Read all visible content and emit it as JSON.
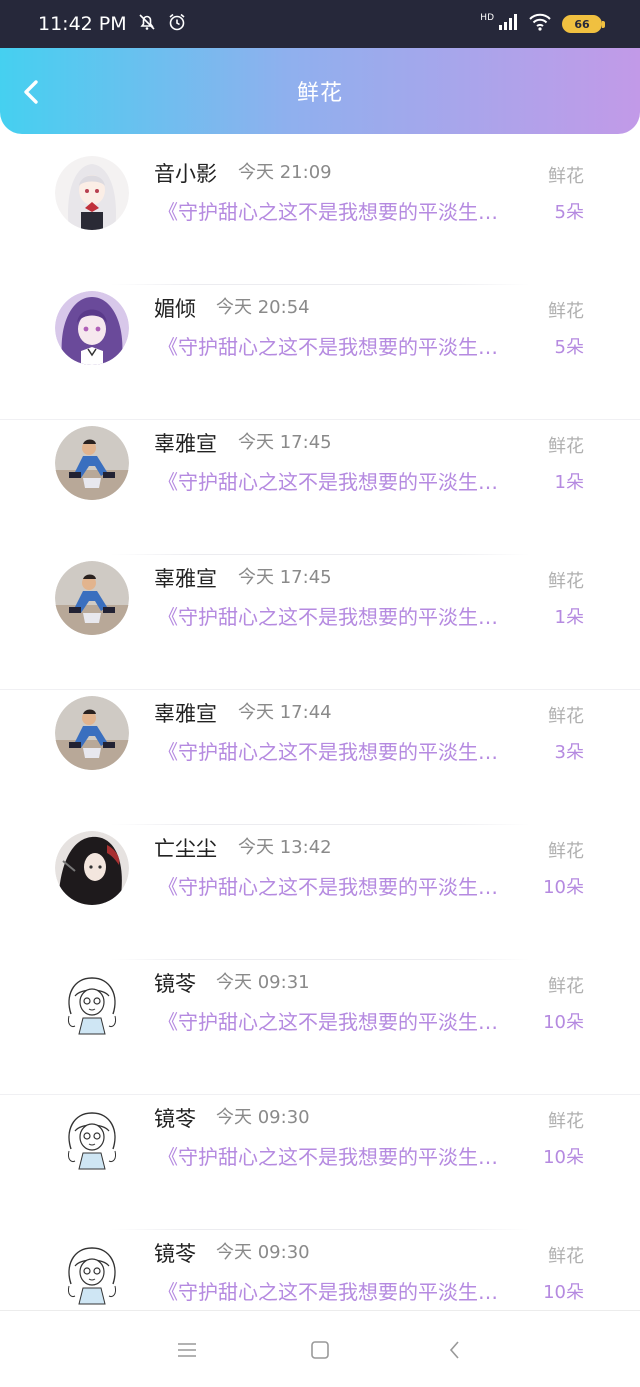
{
  "status": {
    "time": "11:42 PM",
    "network": "HD",
    "battery": "66"
  },
  "header": {
    "title": "鲜花"
  },
  "items": [
    {
      "name": "音小影",
      "time": "今天 21:09",
      "desc": "《守护甜心之这不是我想要的平淡生…",
      "label": "鲜花",
      "count": "5朵",
      "avatar": "anime-girl-white-hair"
    },
    {
      "name": "媚倾",
      "time": "今天 20:54",
      "desc": "《守护甜心之这不是我想要的平淡生…",
      "label": "鲜花",
      "count": "5朵",
      "avatar": "anime-girl-purple-hair"
    },
    {
      "name": "辜雅宣",
      "time": "今天 17:45",
      "desc": "《守护甜心之这不是我想要的平淡生…",
      "label": "鲜花",
      "count": "1朵",
      "avatar": "photo-person"
    },
    {
      "name": "辜雅宣",
      "time": "今天 17:45",
      "desc": "《守护甜心之这不是我想要的平淡生…",
      "label": "鲜花",
      "count": "1朵",
      "avatar": "photo-person"
    },
    {
      "name": "辜雅宣",
      "time": "今天 17:44",
      "desc": "《守护甜心之这不是我想要的平淡生…",
      "label": "鲜花",
      "count": "3朵",
      "avatar": "photo-person"
    },
    {
      "name": "亡尘尘",
      "time": "今天 13:42",
      "desc": "《守护甜心之这不是我想要的平淡生…",
      "label": "鲜花",
      "count": "10朵",
      "avatar": "anime-dark-hair"
    },
    {
      "name": "镜苓",
      "time": "今天 09:31",
      "desc": "《守护甜心之这不是我想要的平淡生…",
      "label": "鲜花",
      "count": "10朵",
      "avatar": "sketch-girl"
    },
    {
      "name": "镜苓",
      "time": "今天 09:30",
      "desc": "《守护甜心之这不是我想要的平淡生…",
      "label": "鲜花",
      "count": "10朵",
      "avatar": "sketch-girl"
    },
    {
      "name": "镜苓",
      "time": "今天 09:30",
      "desc": "《守护甜心之这不是我想要的平淡生…",
      "label": "鲜花",
      "count": "10朵",
      "avatar": "sketch-girl"
    }
  ],
  "colors": {
    "accent": "#b58ae0",
    "header_start": "#45d0f0",
    "header_end": "#c29ae8"
  }
}
